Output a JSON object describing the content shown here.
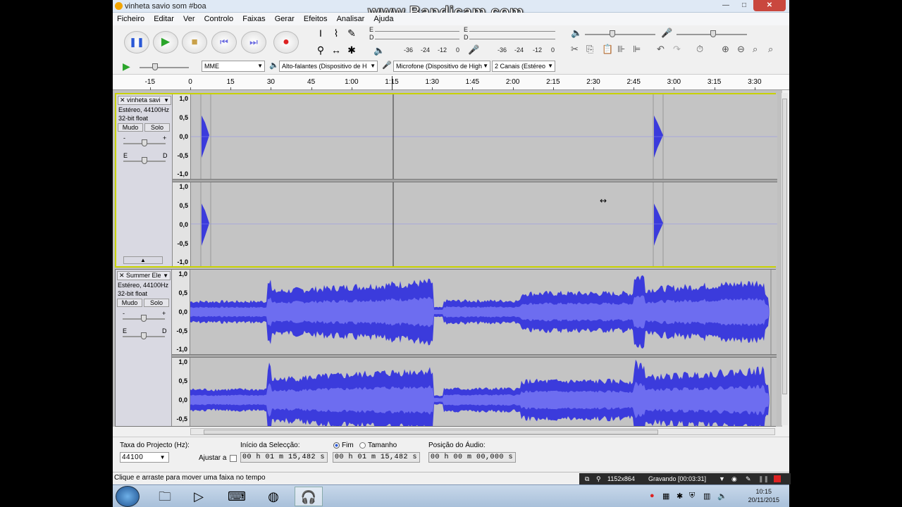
{
  "window": {
    "title": "vinheta savio som #boa"
  },
  "overlay": {
    "watermark": "www.Bandicam.com"
  },
  "controls": {
    "min": "—",
    "max": "□",
    "close": "✕"
  },
  "menu": [
    "Ficheiro",
    "Editar",
    "Ver",
    "Controlo",
    "Faixas",
    "Gerar",
    "Efeitos",
    "Analisar",
    "Ajuda"
  ],
  "meters": {
    "playback": {
      "left_right": [
        "E",
        "D"
      ],
      "scale": [
        "-36",
        "-24",
        "-12",
        "0"
      ]
    },
    "record": {
      "left_right": [
        "E",
        "D"
      ],
      "scale": [
        "-36",
        "-24",
        "-12",
        "0"
      ]
    }
  },
  "device": {
    "host": "MME",
    "output": "Alto-falantes (Dispositivo de H",
    "input": "Microfone (Dispositivo de High",
    "channels": "2 Canais (Estéreo"
  },
  "ruler": {
    "ticks": [
      "-15",
      "0",
      "15",
      "30",
      "45",
      "1:00",
      "1:15",
      "1:30",
      "1:45",
      "2:00",
      "2:15",
      "2:30",
      "2:45",
      "3:00",
      "3:15",
      "3:30"
    ]
  },
  "tracks": [
    {
      "name": "vinheta savi",
      "format": "Estéreo, 44100Hz",
      "bits": "32-bit float",
      "mute": "Mudo",
      "solo": "Solo",
      "gain_minus": "-",
      "gain_plus": "+",
      "pan_left": "E",
      "pan_right": "D"
    },
    {
      "name": "Summer Ele",
      "format": "Estéreo, 44100Hz",
      "bits": "32-bit float",
      "mute": "Mudo",
      "solo": "Solo",
      "gain_minus": "-",
      "gain_plus": "+",
      "pan_left": "E",
      "pan_right": "D"
    }
  ],
  "scale_labels": [
    "1,0",
    "0,5",
    "0,0",
    "-0,5",
    "-1,0"
  ],
  "selection_toolbar": {
    "rate_label": "Taxa do Projecto (Hz):",
    "rate_value": "44100",
    "snap_label": "Ajustar a",
    "start_label": "Início da Selecção:",
    "end_radio": "Fim",
    "length_radio": "Tamanho",
    "start_time": "00 h 01 m 15,482 s",
    "end_time": "00 h 01 m 15,482 s",
    "position_label": "Posição do Áudio:",
    "position_time": "00 h 00 m 00,000 s"
  },
  "status": "Clique e arraste para mover uma faixa no tempo",
  "bandicam_bar": {
    "resolution": "1152x864",
    "recording": "Gravando [00:03:31]"
  },
  "clock": {
    "time": "10:15",
    "date": "20/11/2015"
  },
  "colors": {
    "waveform": "#3b3bdc",
    "waveform_light": "#6d6df0",
    "selection_border": "#c8d200",
    "record": "#dd2222"
  }
}
